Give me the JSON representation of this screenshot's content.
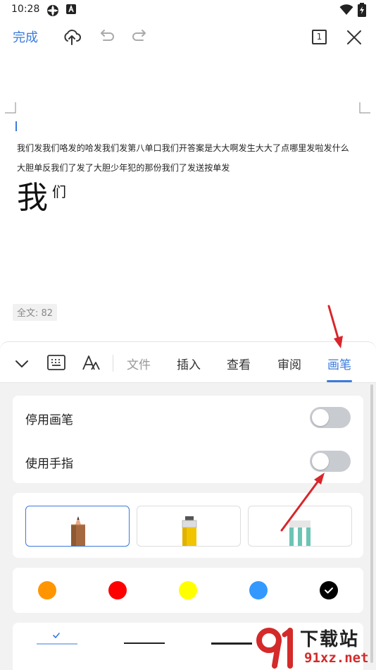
{
  "status_bar": {
    "time": "10:28"
  },
  "toolbar": {
    "done_label": "完成",
    "page_count": "1"
  },
  "document": {
    "line1": "我们发我们咯发的哈发我们发第八单口我们开答案是大大啊发生大大了点哪里发啦发什么",
    "line2": "大胆单反我们了发了大胆少年犯的那份我们了发送按单发",
    "big_char": "我",
    "sup_char": "们",
    "word_count": "全文: 82"
  },
  "tabs": [
    {
      "label": "文件",
      "state": "dim"
    },
    {
      "label": "插入",
      "state": "normal"
    },
    {
      "label": "查看",
      "state": "normal"
    },
    {
      "label": "审阅",
      "state": "normal"
    },
    {
      "label": "画笔",
      "state": "active"
    }
  ],
  "pen_settings": {
    "disable_pen_label": "停用画笔",
    "disable_pen_on": false,
    "use_finger_label": "使用手指",
    "use_finger_on": false
  },
  "pen_types": [
    {
      "name": "pencil",
      "selected": true
    },
    {
      "name": "highlighter",
      "selected": false
    },
    {
      "name": "eraser",
      "selected": false
    }
  ],
  "colors": [
    {
      "name": "orange",
      "hex": "#ff9500"
    },
    {
      "name": "red",
      "hex": "#ff0000"
    },
    {
      "name": "yellow",
      "hex": "#ffff00"
    },
    {
      "name": "blue",
      "hex": "#3399ff"
    },
    {
      "name": "black",
      "hex": "#000000",
      "selected": true
    }
  ],
  "accent_color": "#3a7bdc",
  "watermark": {
    "title": "下载站",
    "domain": "91xz.net"
  }
}
